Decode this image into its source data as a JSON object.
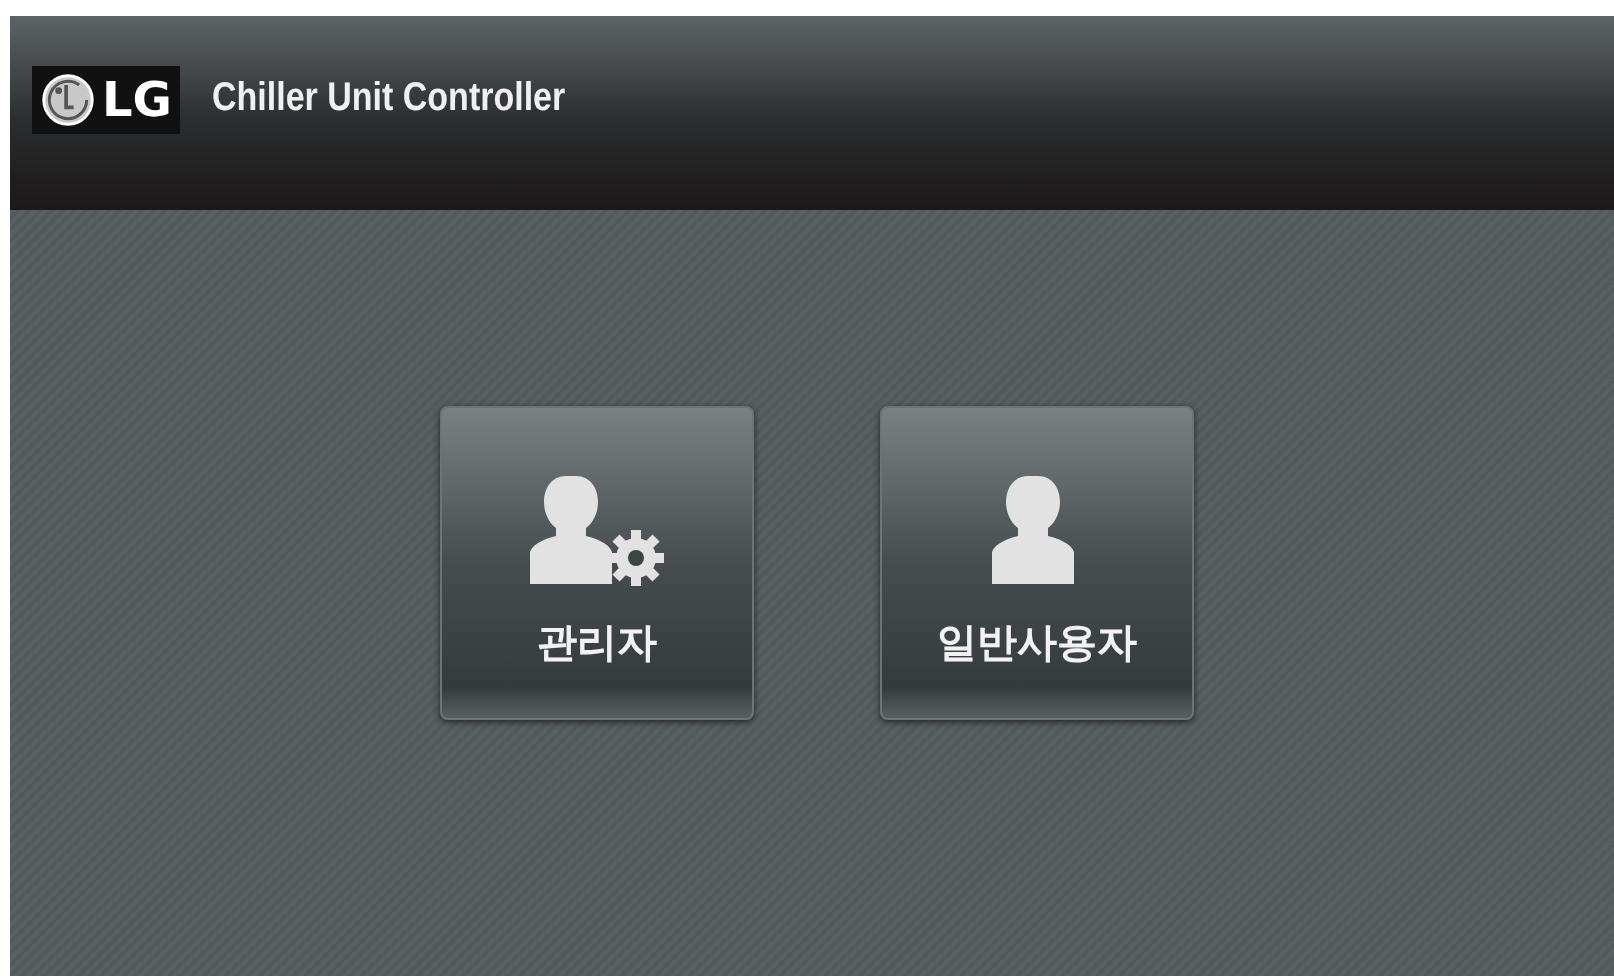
{
  "header": {
    "logo": "LG",
    "title": "Chiller Unit Controller"
  },
  "buttons": [
    {
      "kind": "admin",
      "label": "관리자"
    },
    {
      "kind": "user",
      "label": "일반사용자"
    }
  ]
}
